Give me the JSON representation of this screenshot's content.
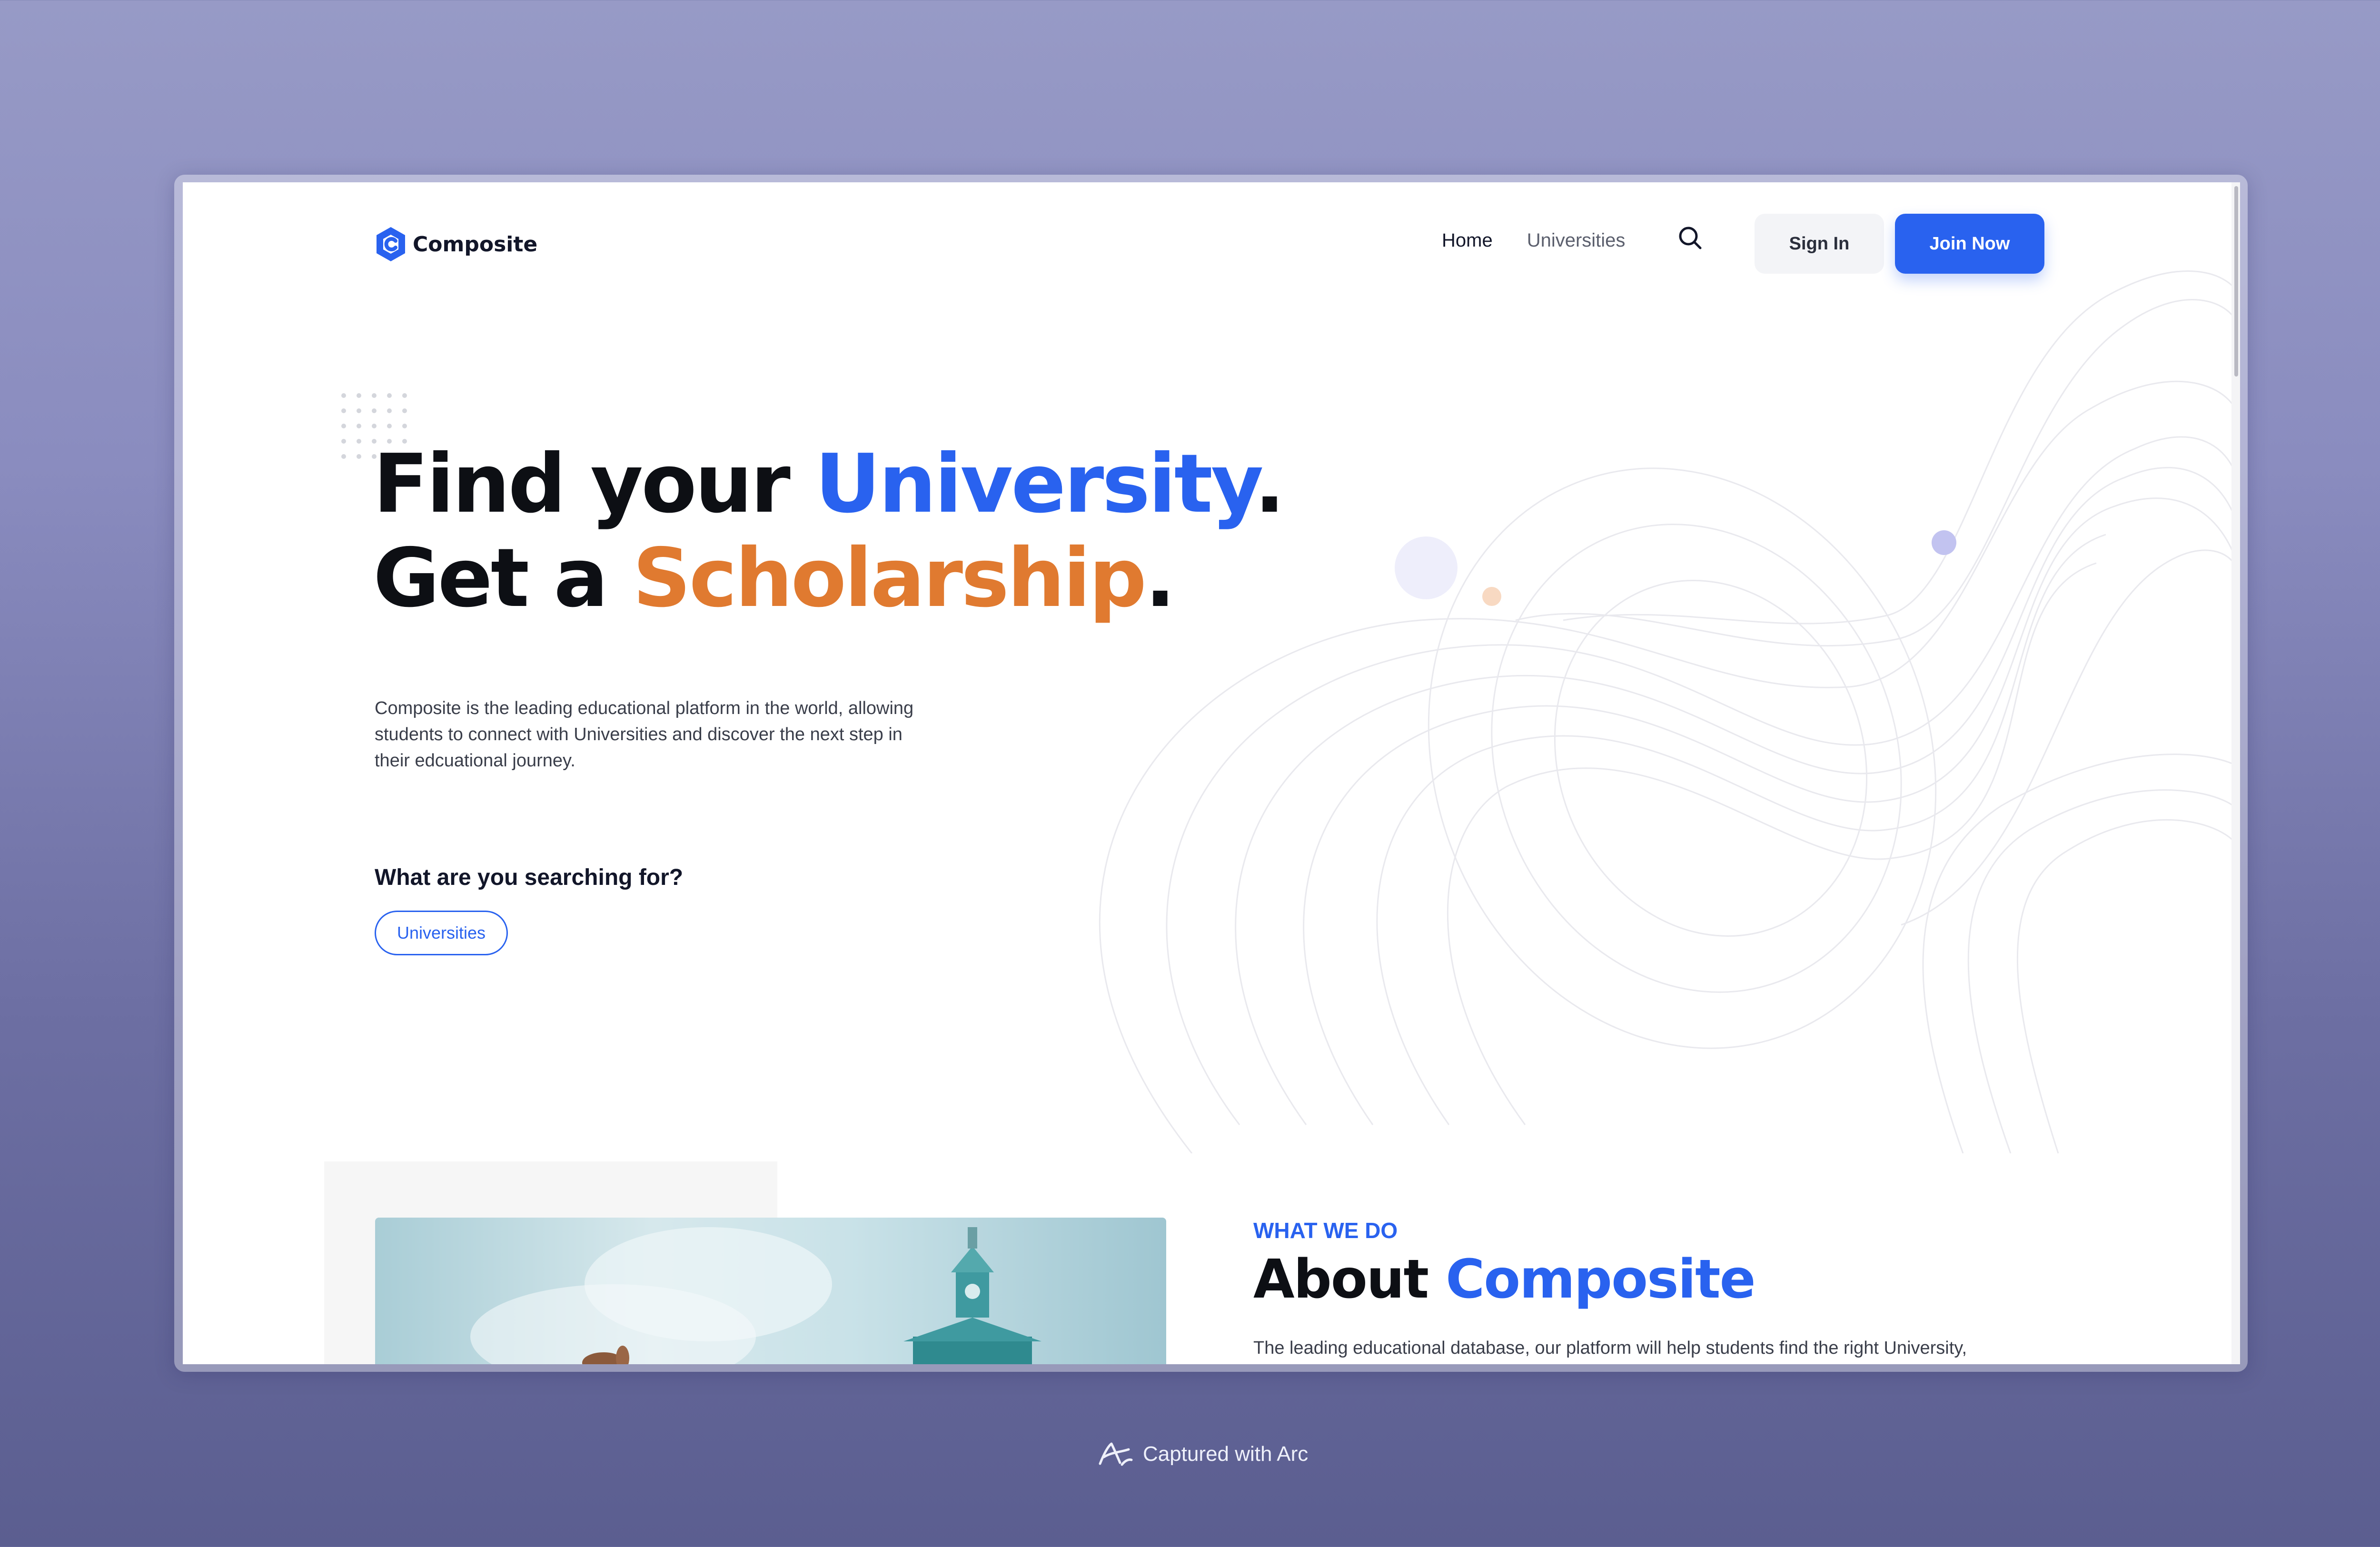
{
  "brand": {
    "name": "Composite",
    "accent_blue": "#2962ef",
    "accent_orange": "#e07a30"
  },
  "nav": {
    "links": [
      {
        "label": "Home",
        "active": true
      },
      {
        "label": "Universities",
        "active": false
      }
    ],
    "search_icon": "search-icon",
    "sign_in_label": "Sign In",
    "join_label": "Join Now"
  },
  "hero": {
    "title_line1_prefix": "Find your ",
    "title_line1_highlight": "University",
    "title_line1_suffix": ".",
    "title_line2_prefix": "Get a ",
    "title_line2_highlight": "Scholarship",
    "title_line2_suffix": ".",
    "description": "Composite is the leading educational platform in the world, allowing students to connect with Universities and discover the next step in their edcuational journey.",
    "search_heading": "What are you searching for?",
    "chip_label": "Universities"
  },
  "about": {
    "eyebrow": "WHAT WE DO",
    "title_prefix": "About ",
    "title_highlight": "Composite",
    "body": "The leading educational database, our platform will help students find the right University,"
  },
  "footer_caption": {
    "text": "Captured with Arc",
    "icon": "arc-logo-icon"
  }
}
